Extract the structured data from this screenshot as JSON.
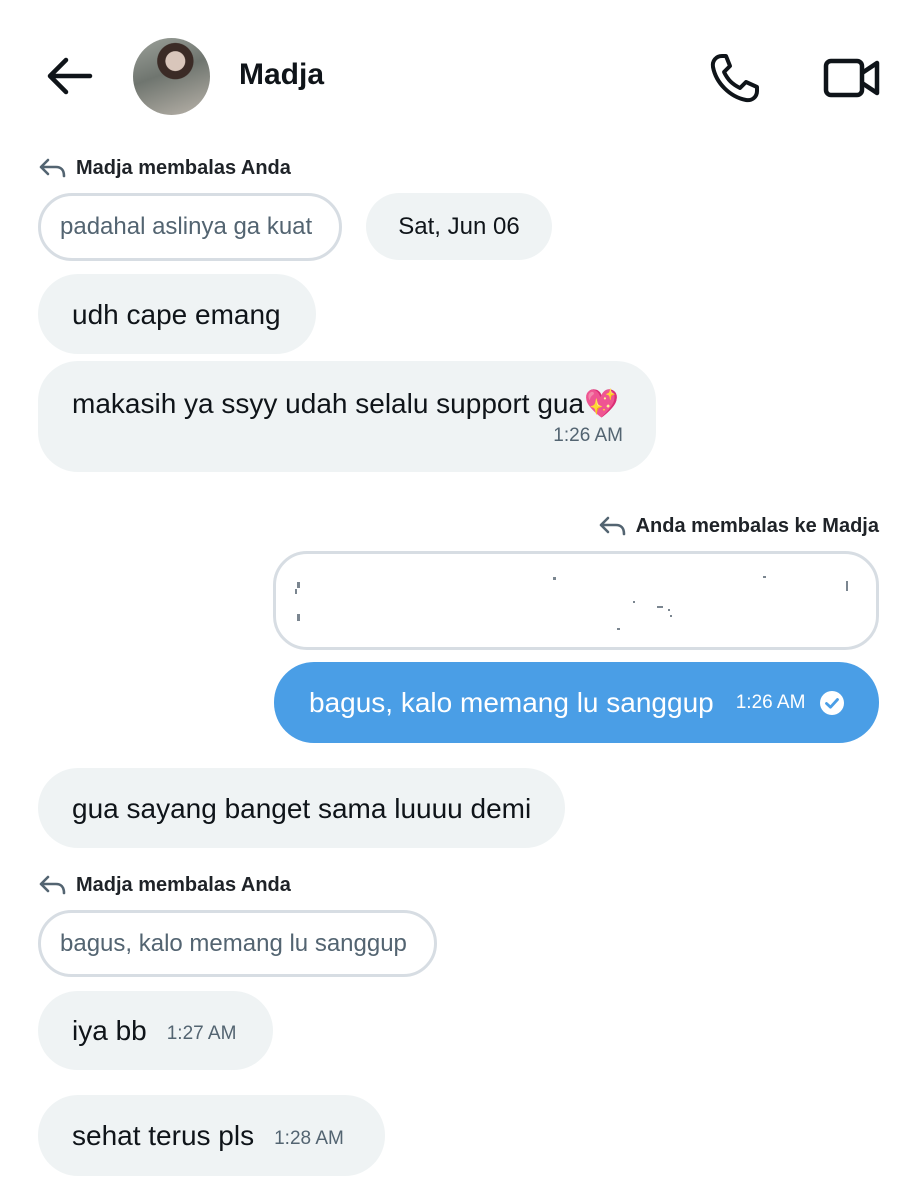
{
  "header": {
    "contact_name": "Madja"
  },
  "messages": {
    "reply1": {
      "header": "Madja membalas Anda",
      "quote": "padahal aslinya ga kuat"
    },
    "date_separator": "Sat, Jun 06",
    "m1": {
      "text": "udh cape emang"
    },
    "m2": {
      "text": "makasih ya ssyy udah selalu support gua💖",
      "time": "1:26 AM"
    },
    "reply2": {
      "header": "Anda membalas ke Madja"
    },
    "m3": {
      "text": "bagus, kalo memang lu sanggup",
      "time": "1:26 AM",
      "status": "read-check-icon"
    },
    "m4": {
      "text": "gua sayang banget sama luuuu demi"
    },
    "reply3": {
      "header": "Madja membalas Anda",
      "quote": "bagus, kalo memang lu sanggup"
    },
    "m5": {
      "text": "iya bb",
      "time": "1:27 AM"
    },
    "m6": {
      "text": "sehat terus pls",
      "time": "1:28 AM"
    }
  },
  "colors": {
    "sent_bubble": "#4a9ee6",
    "received_bubble": "#eff3f4",
    "quote_border": "#d7dde3"
  }
}
